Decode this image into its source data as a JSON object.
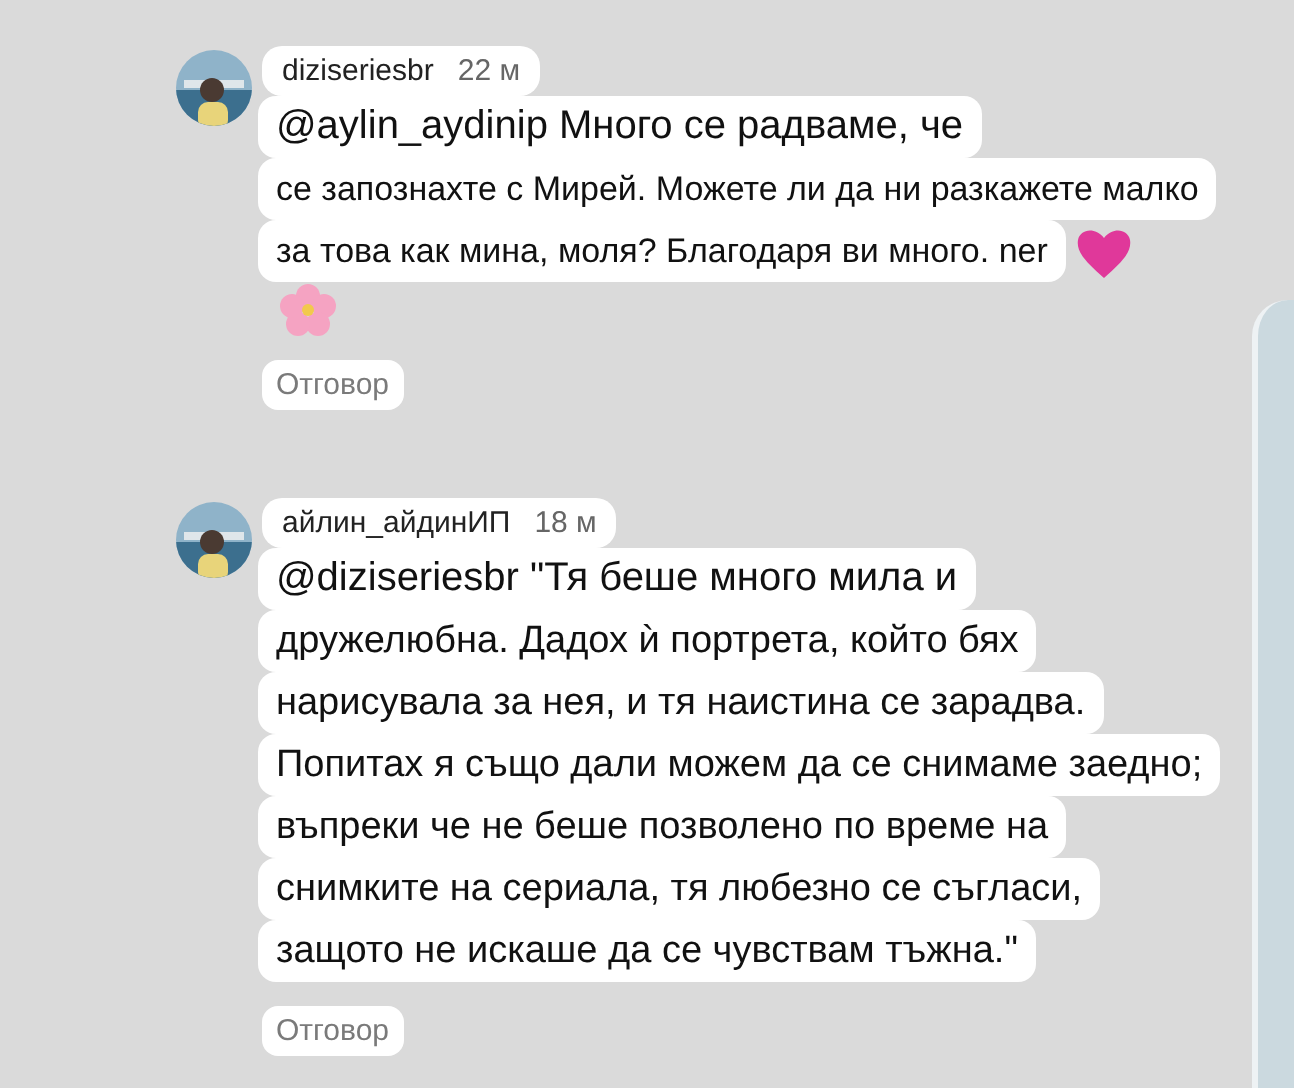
{
  "comments": [
    {
      "author": "diziseriesbr",
      "time": "22 м",
      "lines": [
        {
          "text": "@aylin_aydinip Много се радваме, че"
        },
        {
          "text": "се запознахте с Мирей. Можете ли да ни разкажете малко"
        },
        {
          "text": "за това как мина, моля? Благодаря ви много. ner",
          "icon": {
            "kind": "heart"
          }
        }
      ],
      "after_icon": {
        "kind": "flower"
      },
      "reply": "Отговор"
    },
    {
      "author": "айлин_айдинИП",
      "time": "18 м",
      "lines": [
        {
          "text": "@diziseriesbr \"Тя беше много мила и"
        },
        {
          "text": "дружелюбна. Дадох ѝ портрета, който бях"
        },
        {
          "text": "нарисувала за нея, и тя наистина се зарадва."
        },
        {
          "text": "Попитах я също дали можем да се снимаме заедно;"
        },
        {
          "text": "въпреки че не беше позволено по време на"
        },
        {
          "text": "снимките на сериала, тя любезно се съгласи,"
        },
        {
          "text": "защото не искаше да се чувствам тъжна.\""
        }
      ],
      "reply": "Отговор"
    }
  ]
}
